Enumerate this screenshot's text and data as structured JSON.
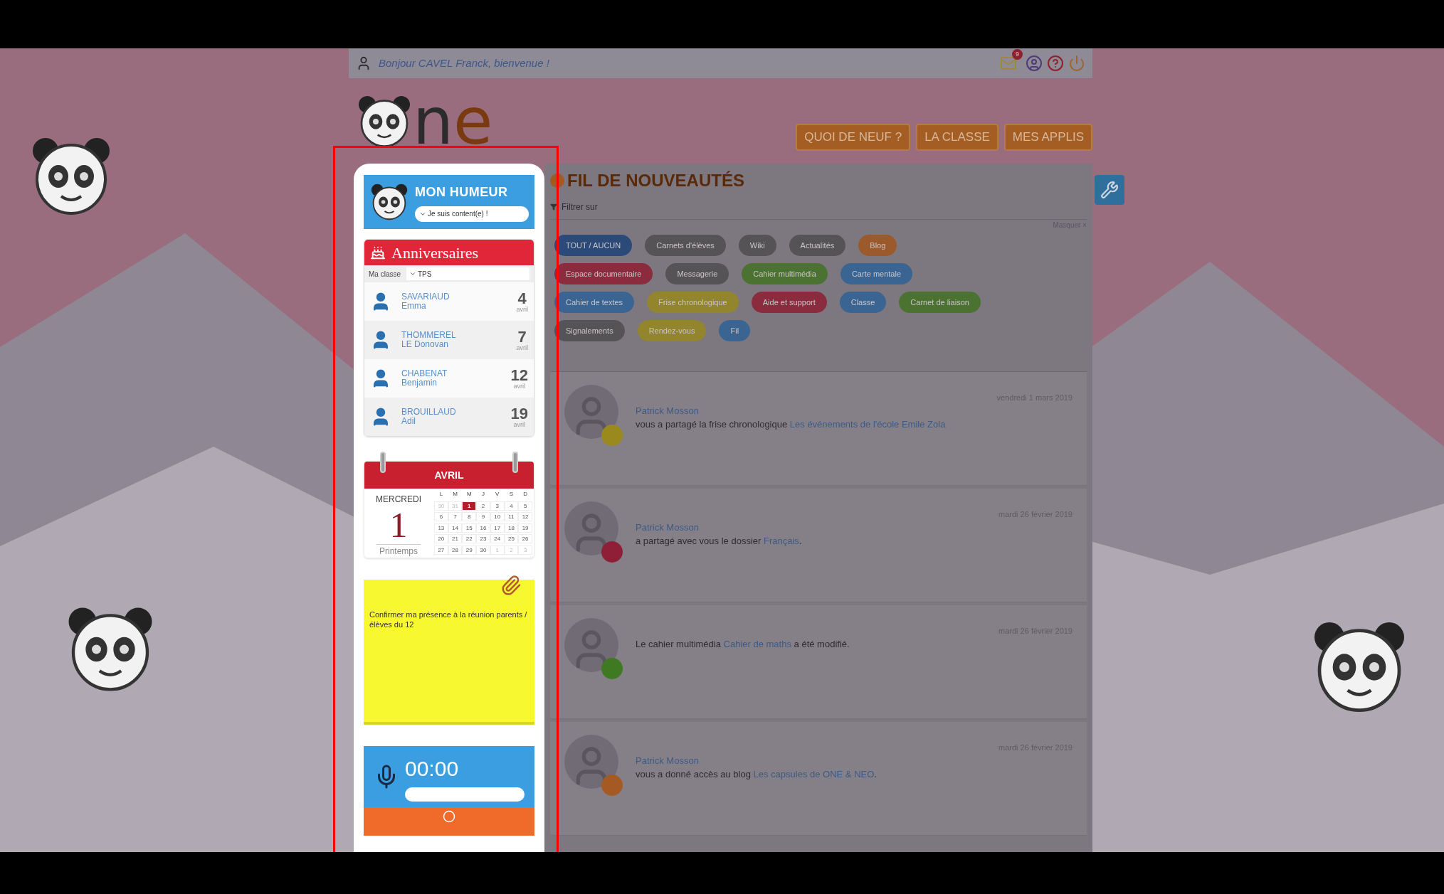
{
  "header": {
    "greeting": "Bonjour CAVEL Franck, bienvenue !",
    "mail_count": "9"
  },
  "logo": {
    "parts": [
      {
        "text": "n",
        "color": "#2b2b2b"
      },
      {
        "text": "e",
        "color": "#7a3a10"
      }
    ]
  },
  "nav": [
    {
      "label": "QUOI DE NEUF ?",
      "selected": false
    },
    {
      "label": "LA CLASSE",
      "selected": false
    },
    {
      "label": "MES APPLIS",
      "selected": false
    }
  ],
  "mood": {
    "title": "MON HUMEUR",
    "value": "Je suis content(e) !"
  },
  "birthdays": {
    "title": "Anniversaires",
    "filter_label": "Ma classe",
    "filter_value": "TPS",
    "rows": [
      {
        "last": "SAVARIAUD",
        "first": "Emma",
        "day": "4",
        "month": "avril"
      },
      {
        "last": "THOMMEREL",
        "first": "LE Donovan",
        "day": "7",
        "month": "avril"
      },
      {
        "last": "CHABENAT",
        "first": "Benjamin",
        "day": "12",
        "month": "avril"
      },
      {
        "last": "BROUILLAUD",
        "first": "Adil",
        "day": "19",
        "month": "avril"
      }
    ]
  },
  "calendar": {
    "month": "AVRIL",
    "weekday": "MERCREDI",
    "day": "1",
    "season": "Printemps",
    "headers": [
      "L",
      "M",
      "M",
      "J",
      "V",
      "S",
      "D"
    ],
    "days": [
      {
        "d": "30",
        "outside": true,
        "today": false
      },
      {
        "d": "31",
        "outside": true,
        "today": false
      },
      {
        "d": "1",
        "outside": false,
        "today": true
      },
      {
        "d": "2",
        "outside": false,
        "today": false
      },
      {
        "d": "3",
        "outside": false,
        "today": false
      },
      {
        "d": "4",
        "outside": false,
        "today": false
      },
      {
        "d": "5",
        "outside": false,
        "today": false
      },
      {
        "d": "6",
        "outside": false,
        "today": false
      },
      {
        "d": "7",
        "outside": false,
        "today": false
      },
      {
        "d": "8",
        "outside": false,
        "today": false
      },
      {
        "d": "9",
        "outside": false,
        "today": false
      },
      {
        "d": "10",
        "outside": false,
        "today": false
      },
      {
        "d": "11",
        "outside": false,
        "today": false
      },
      {
        "d": "12",
        "outside": false,
        "today": false
      },
      {
        "d": "13",
        "outside": false,
        "today": false
      },
      {
        "d": "14",
        "outside": false,
        "today": false
      },
      {
        "d": "15",
        "outside": false,
        "today": false
      },
      {
        "d": "16",
        "outside": false,
        "today": false
      },
      {
        "d": "17",
        "outside": false,
        "today": false
      },
      {
        "d": "18",
        "outside": false,
        "today": false
      },
      {
        "d": "19",
        "outside": false,
        "today": false
      },
      {
        "d": "20",
        "outside": false,
        "today": false
      },
      {
        "d": "21",
        "outside": false,
        "today": false
      },
      {
        "d": "22",
        "outside": false,
        "today": false
      },
      {
        "d": "23",
        "outside": false,
        "today": false
      },
      {
        "d": "24",
        "outside": false,
        "today": false
      },
      {
        "d": "25",
        "outside": false,
        "today": false
      },
      {
        "d": "26",
        "outside": false,
        "today": false
      },
      {
        "d": "27",
        "outside": false,
        "today": false
      },
      {
        "d": "28",
        "outside": false,
        "today": false
      },
      {
        "d": "29",
        "outside": false,
        "today": false
      },
      {
        "d": "30",
        "outside": false,
        "today": false
      },
      {
        "d": "1",
        "outside": true,
        "today": false
      },
      {
        "d": "2",
        "outside": true,
        "today": false
      },
      {
        "d": "3",
        "outside": true,
        "today": false
      }
    ]
  },
  "note": {
    "text": "Confirmer ma présence à la réunion parents / élèves du 12"
  },
  "recorder": {
    "time": "00:00"
  },
  "feed": {
    "title": "FIL DE NOUVEAUTÉS",
    "filter_label": "Filtrer sur",
    "hide_label": "Masquer ×",
    "chips": [
      [
        {
          "label": "TOUT / AUCUN",
          "color": "#2c4a78"
        },
        {
          "label": "Carnets d'élèves",
          "color": "#565357"
        },
        {
          "label": "Wiki",
          "color": "#565357"
        },
        {
          "label": "Actualités",
          "color": "#565357"
        },
        {
          "label": "Blog",
          "color": "#9a5a2c"
        }
      ],
      [
        {
          "label": "Espace documentaire",
          "color": "#8a2c3e"
        },
        {
          "label": "Messagerie",
          "color": "#565357"
        },
        {
          "label": "Cahier multimédia",
          "color": "#4c7232"
        },
        {
          "label": "Carte mentale",
          "color": "#3a6592"
        }
      ],
      [
        {
          "label": "Cahier de textes",
          "color": "#3a6592"
        },
        {
          "label": "Frise chronologique",
          "color": "#93842e"
        },
        {
          "label": "Aide et support",
          "color": "#8a2c3e"
        },
        {
          "label": "Classe",
          "color": "#3a6592"
        },
        {
          "label": "Carnet de liaison",
          "color": "#4c7232"
        }
      ],
      [
        {
          "label": "Signalements",
          "color": "#565357"
        },
        {
          "label": "Rendez-vous",
          "color": "#93842e"
        },
        {
          "label": "Fil",
          "color": "#3a6592"
        }
      ]
    ],
    "items": [
      {
        "date": "vendredi 1 mars 2019",
        "author": "Patrick Mosson",
        "text": "vous a partagé la frise chronologique ",
        "link": "Les événements de l'école Emile Zola",
        "color": "#9a8a1e"
      },
      {
        "date": "mardi 26 février 2019",
        "author": "Patrick Mosson",
        "text": "a partagé avec vous le dossier ",
        "link": "Français",
        "after": ".",
        "color": "#8e1f37"
      },
      {
        "date": "mardi 26 février 2019",
        "text": "Le cahier multimédia ",
        "link": "Cahier de maths",
        "after": " a été modifié.",
        "color": "#3f7a22"
      },
      {
        "date": "mardi 26 février 2019",
        "author": "Patrick Mosson",
        "text": "vous a donné accès au blog ",
        "link": "Les capsules de ONE & NEO",
        "after": ".",
        "color": "#a55a24"
      }
    ]
  }
}
